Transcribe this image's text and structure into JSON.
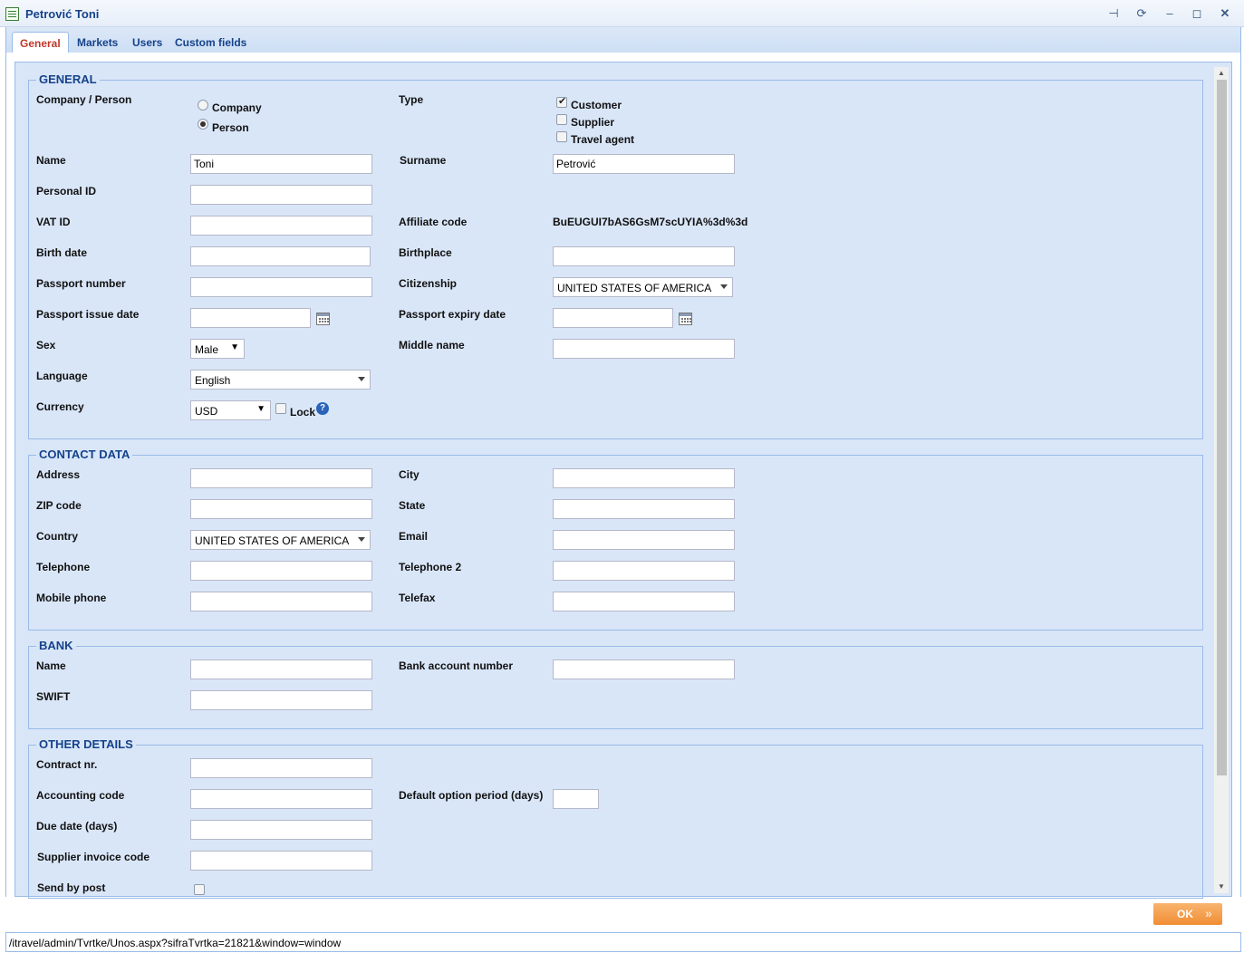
{
  "window": {
    "title": "Petrović Toni",
    "buttons": [
      "pin-icon",
      "refresh-icon",
      "minimize-icon",
      "maximize-icon",
      "close-icon"
    ]
  },
  "tabs": [
    {
      "label": "General",
      "active": true
    },
    {
      "label": "Markets",
      "active": false
    },
    {
      "label": "Users",
      "active": false
    },
    {
      "label": "Custom fields",
      "active": false
    }
  ],
  "general": {
    "legend": "GENERAL",
    "company_person_label": "Company / Person",
    "company_option": "Company",
    "person_option": "Person",
    "selected": "Person",
    "type_label": "Type",
    "type_customer": "Customer",
    "type_supplier": "Supplier",
    "type_travel_agent": "Travel agent",
    "name_label": "Name",
    "name_value": "Toni",
    "surname_label": "Surname",
    "surname_value": "Petrović",
    "personal_id_label": "Personal ID",
    "vat_id_label": "VAT ID",
    "affiliate_label": "Affiliate code",
    "affiliate_value": "BuEUGUI7bAS6GsM7scUYIA%3d%3d",
    "birth_date_label": "Birth date",
    "birthplace_label": "Birthplace",
    "passport_number_label": "Passport number",
    "citizenship_label": "Citizenship",
    "citizenship_value": "UNITED STATES OF AMERICA",
    "passport_issue_label": "Passport issue date",
    "passport_expiry_label": "Passport expiry date",
    "sex_label": "Sex",
    "sex_value": "Male",
    "middle_name_label": "Middle name",
    "language_label": "Language",
    "language_value": "English",
    "currency_label": "Currency",
    "currency_value": "USD",
    "lock_label": "Lock",
    "help_glyph": "?"
  },
  "contact": {
    "legend": "CONTACT DATA",
    "address_label": "Address",
    "city_label": "City",
    "zip_label": "ZIP code",
    "state_label": "State",
    "country_label": "Country",
    "country_value": "UNITED STATES OF AMERICA",
    "email_label": "Email",
    "telephone_label": "Telephone",
    "telephone2_label": "Telephone 2",
    "mobile_label": "Mobile phone",
    "telefax_label": "Telefax"
  },
  "bank": {
    "legend": "BANK",
    "name_label": "Name",
    "account_label": "Bank account number",
    "swift_label": "SWIFT"
  },
  "other": {
    "legend": "OTHER DETAILS",
    "contract_label": "Contract nr.",
    "accounting_label": "Accounting code",
    "default_option_label": "Default option period (days)",
    "due_date_label": "Due date (days)",
    "supplier_invoice_label": "Supplier invoice code",
    "send_by_post_label": "Send by post"
  },
  "footer": {
    "ok_label": "OK",
    "status_url": "/itravel/admin/Tvrtke/Unos.aspx?sifraTvrtka=21821&window=window"
  }
}
